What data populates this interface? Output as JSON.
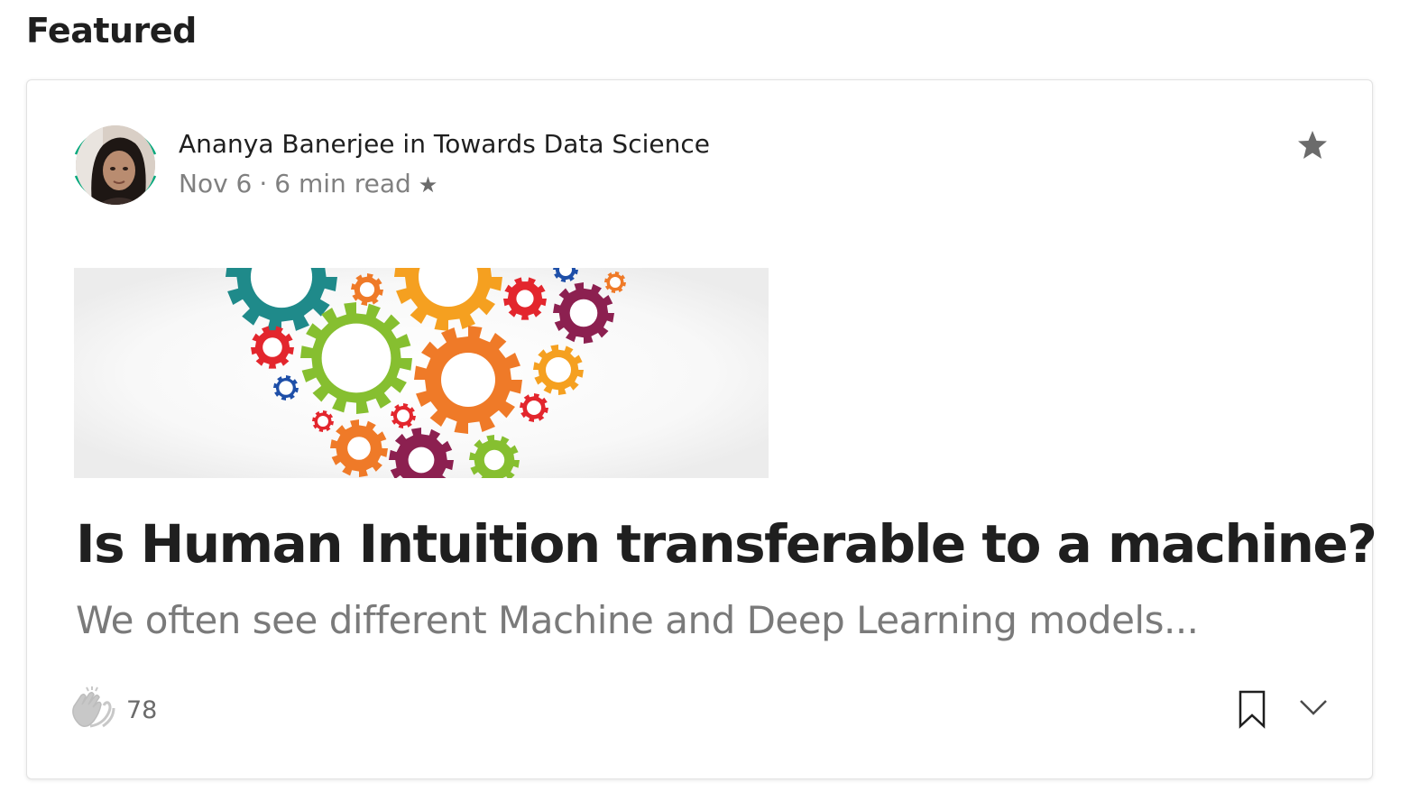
{
  "section": {
    "heading": "Featured"
  },
  "post": {
    "author": "Ananya Banerjee",
    "connector": " in ",
    "publication": "Towards Data Science",
    "date": "Nov 6",
    "separator": "·",
    "read_time": "6 min read",
    "member_star": "★",
    "title": "Is Human Intuition transferable to a machine?",
    "subtitle": "We often see different Machine and Deep Learning models...",
    "claps": "78"
  },
  "icons": {
    "star": "star-icon",
    "clap": "clap-icon",
    "bookmark": "bookmark-icon",
    "more": "chevron-down-icon"
  },
  "colors": {
    "avatar_ring": "#03a87c",
    "title_text": "#1f1f1f",
    "muted_text": "#7a7a7a",
    "icon_gray": "#6b6b6b"
  }
}
